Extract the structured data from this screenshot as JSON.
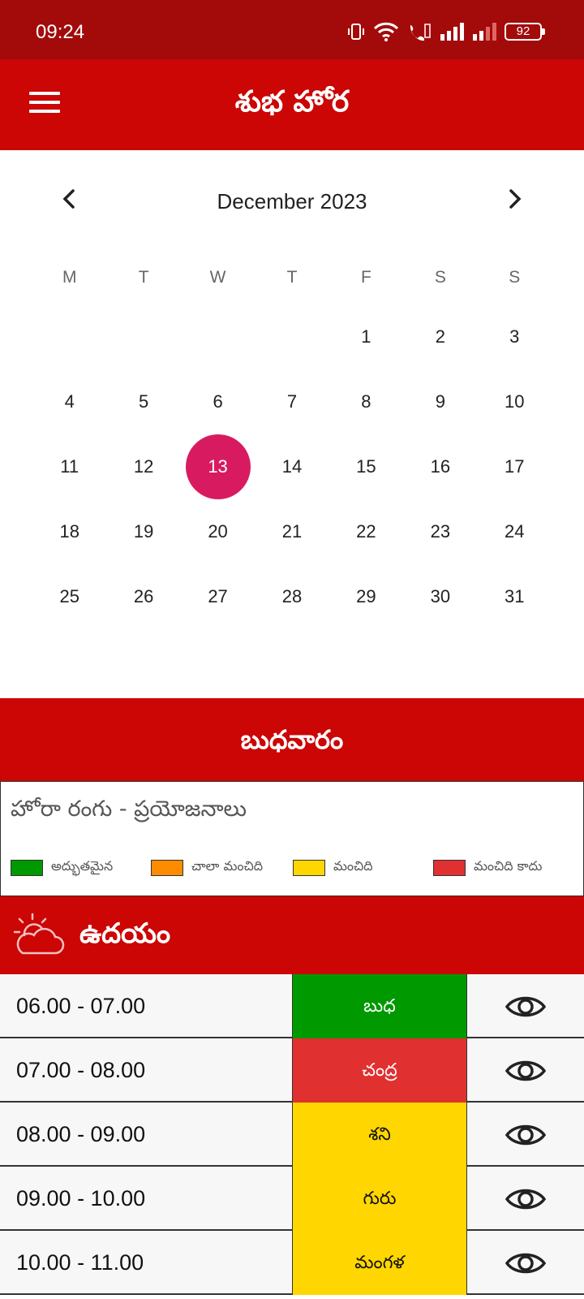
{
  "status_bar": {
    "time": "09:24",
    "battery": "92",
    "icons": [
      "vibrate-icon",
      "wifi-icon",
      "wifi-calling-icon",
      "signal-icon",
      "signal-weak-icon",
      "battery-icon"
    ]
  },
  "app_bar": {
    "title": "శుభ హోర",
    "icon": "menu-icon"
  },
  "calendar": {
    "month_label": "December 2023",
    "weekdays": [
      "M",
      "T",
      "W",
      "T",
      "F",
      "S",
      "S"
    ],
    "leading_blanks": 4,
    "days_in_month": 31,
    "selected_day": 13,
    "selected_color": "#d81b60"
  },
  "day_name": "బుధవారం",
  "legend": {
    "title": "హోరా రంగు - ప్రయోజనాలు",
    "items": [
      {
        "label": "అద్భుతమైన",
        "color": "#009900"
      },
      {
        "label": "చాలా మంచిది",
        "color": "#ff8c00"
      },
      {
        "label": "మంచిది",
        "color": "#ffd600"
      },
      {
        "label": "మంచిది కాదు",
        "color": "#e03030"
      }
    ]
  },
  "section": {
    "title": "ఉదయం",
    "icon": "sunrise-cloud-icon"
  },
  "hora_rows": [
    {
      "time": "06.00 - 07.00",
      "planet": "బుధ",
      "color": "green"
    },
    {
      "time": "07.00 - 08.00",
      "planet": "చంద్ర",
      "color": "red"
    },
    {
      "time": "08.00 - 09.00",
      "planet": "శని",
      "color": "yellow"
    },
    {
      "time": "09.00 - 10.00",
      "planet": "గురు",
      "color": "yellow"
    },
    {
      "time": "10.00 - 11.00",
      "planet": "మంగళ",
      "color": "yellow"
    }
  ],
  "colors": {
    "app_bar": "#cc0505",
    "status_bar": "#a30b0b",
    "good": "#009900",
    "very_good": "#ff8c00",
    "ok": "#ffd600",
    "bad": "#e03030"
  }
}
